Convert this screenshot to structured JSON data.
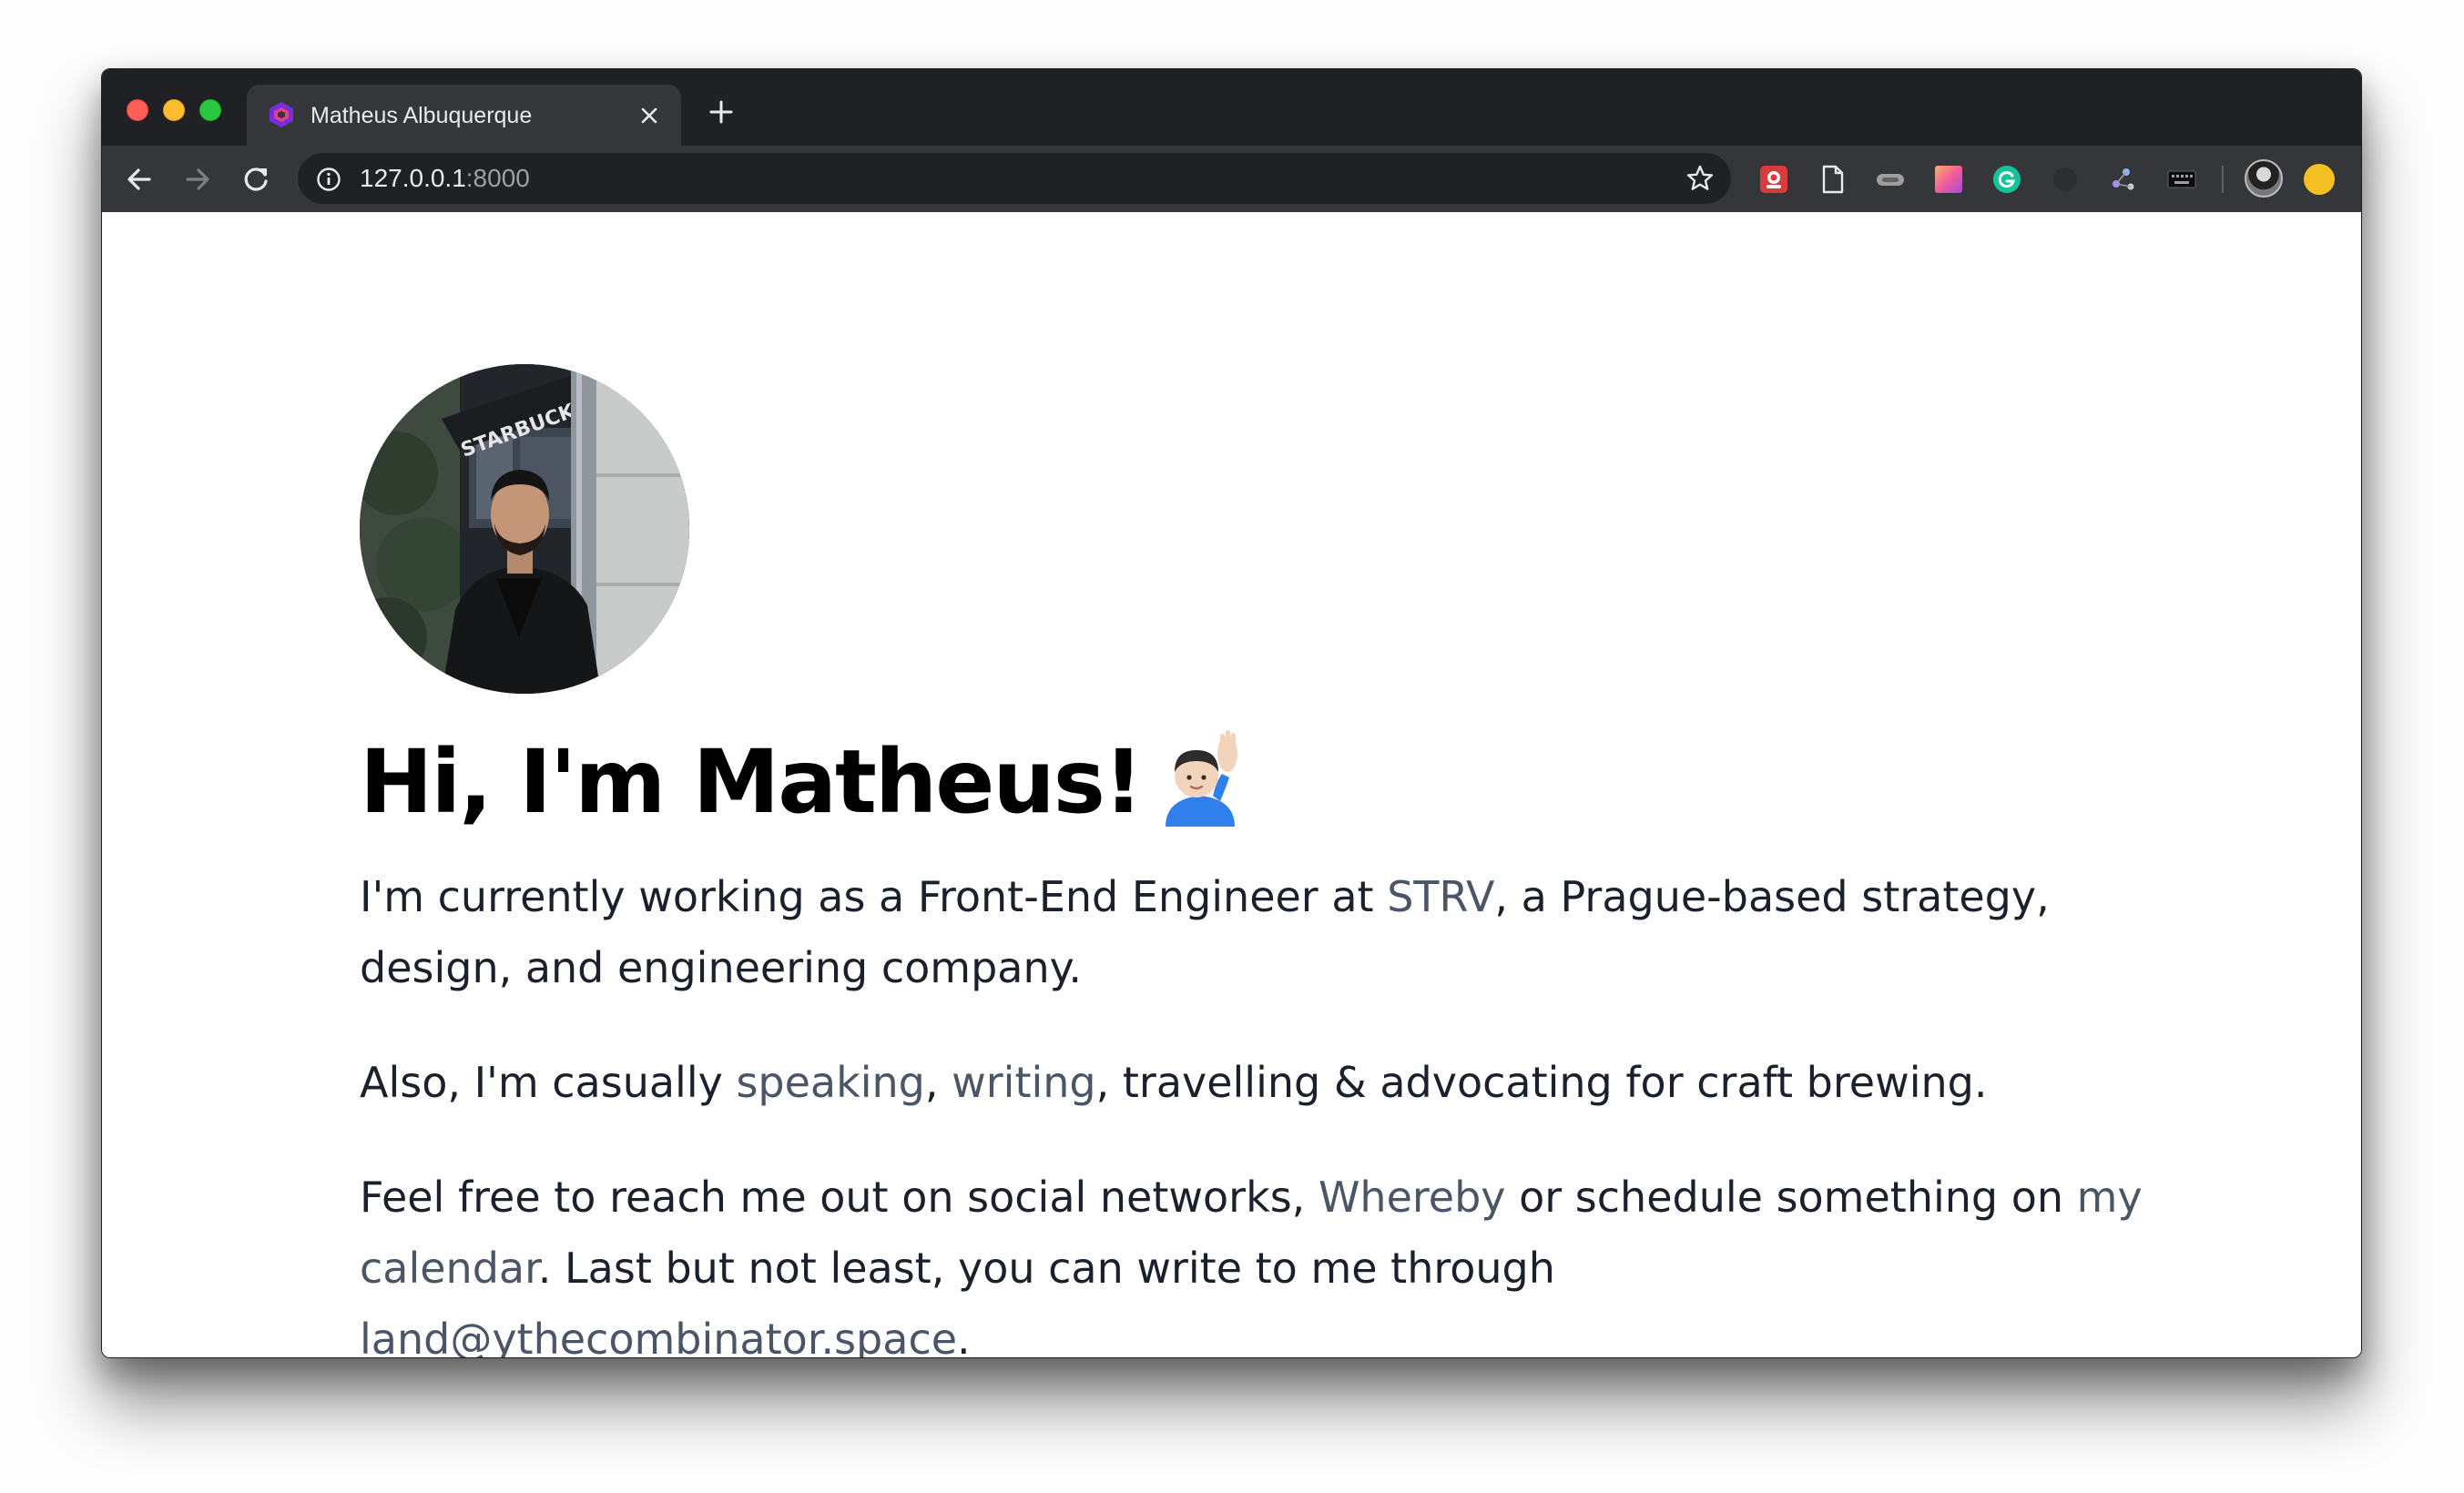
{
  "browser": {
    "tab_title": "Matheus Albuquerque",
    "url_host": "127.0.0.1",
    "url_port": ":8000"
  },
  "icons": {
    "back": "arrow-left-icon",
    "forward": "arrow-right-icon",
    "reload": "reload-icon",
    "site_info": "info-circle-icon",
    "bookmark": "star-outline-icon",
    "close_tab": "close-icon",
    "new_tab": "plus-icon",
    "wave": "person-raising-hand-emoji"
  },
  "colors": {
    "chrome_dark": "#202124",
    "chrome_tab": "#35363a",
    "heading_text": "#000000",
    "body_text": "#1a202c",
    "link_text": "#4a5568"
  },
  "content": {
    "headline": "Hi, I'm Matheus!",
    "p1": {
      "before": "I'm currently working as a Front-End Engineer at ",
      "link_strv": "STRV",
      "after": ", a Prague-based strategy, design, and engineering company."
    },
    "p2": {
      "before": "Also, I'm casually ",
      "link_speaking": "speaking",
      "comma": ", ",
      "link_writing": "writing",
      "after": ", travelling & advocating for craft brewing."
    },
    "p3": {
      "before": "Feel free to reach me out on social networks, ",
      "link_whereby": "Whereby",
      "middle": " or schedule something on ",
      "link_calendar": "my calendar",
      "middle2": ". Last but not least, you can write to me through ",
      "link_email": "land@ythecombinator.space",
      "end": "."
    }
  }
}
